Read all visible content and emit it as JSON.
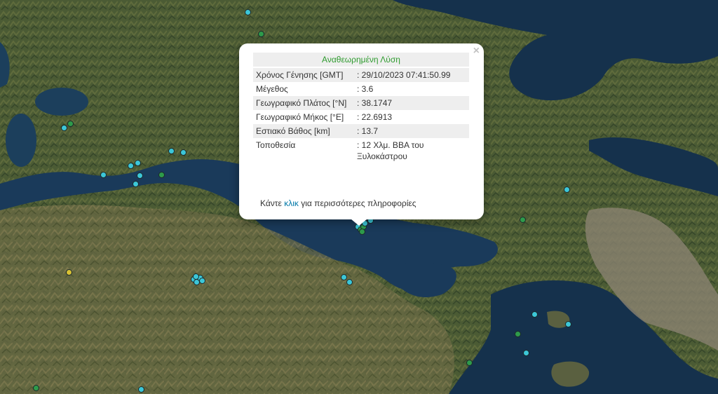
{
  "popup": {
    "title": "Αναθεωρημένη Λύση",
    "close_symbol": "×",
    "rows": [
      {
        "label": "Χρόνος Γένησης [GMT]",
        "value": ": 29/10/2023 07:41:50.99"
      },
      {
        "label": "Μέγεθος",
        "value": ": 3.6"
      },
      {
        "label": "Γεωγραφικό Πλάτος [°N]",
        "value": ": 38.1747"
      },
      {
        "label": "Γεωγραφικό Μήκος [°E]",
        "value": ": 22.6913"
      },
      {
        "label": "Εστιακό Βάθος [km]",
        "value": ": 13.7"
      },
      {
        "label": "Τοποθεσία",
        "value": ": 12 Χλμ. ΒΒΑ του Ξυλοκάστρου"
      }
    ],
    "more_prefix": "Κάντε ",
    "more_link": "κλικ",
    "more_suffix": " για περισσότερες πληροφορίες"
  },
  "colors": {
    "marker_recent": "#3cc7d8",
    "marker_older": "#2e9b4b",
    "marker_other": "#d9c234",
    "sea": "#14324f",
    "land": "#4a5a33"
  }
}
